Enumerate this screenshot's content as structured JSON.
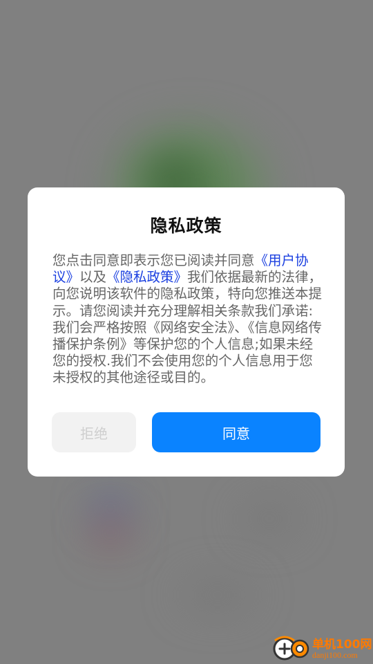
{
  "dialog": {
    "title": "隐私政策",
    "body_intro": "您点击同意即表示您已阅读并同意",
    "link_user_agreement": "《用户协议》",
    "body_and": "以及",
    "link_privacy_policy": "《隐私政策》",
    "body_rest": "我们依据最新的法律，向您说明该软件的隐私政策，特向您推送本提示。请您阅读并充分理解相关条款我们承诺:我们会严格按照《网络安全法》、《信息网络传播保护条例》等保护您的个人信息;如果未经您的授权.我们不会使用您的个人信息用于您未授权的其他途径或目的。",
    "reject_label": "拒绝",
    "agree_label": "同意"
  },
  "watermark": {
    "name": "单机100网",
    "url": "danji100.com"
  },
  "colors": {
    "overlay": "#808080",
    "link": "#1a3fe0",
    "agree_button": "#0a83ff",
    "reject_button": "#f2f2f2",
    "watermark": "#ff7a00"
  }
}
